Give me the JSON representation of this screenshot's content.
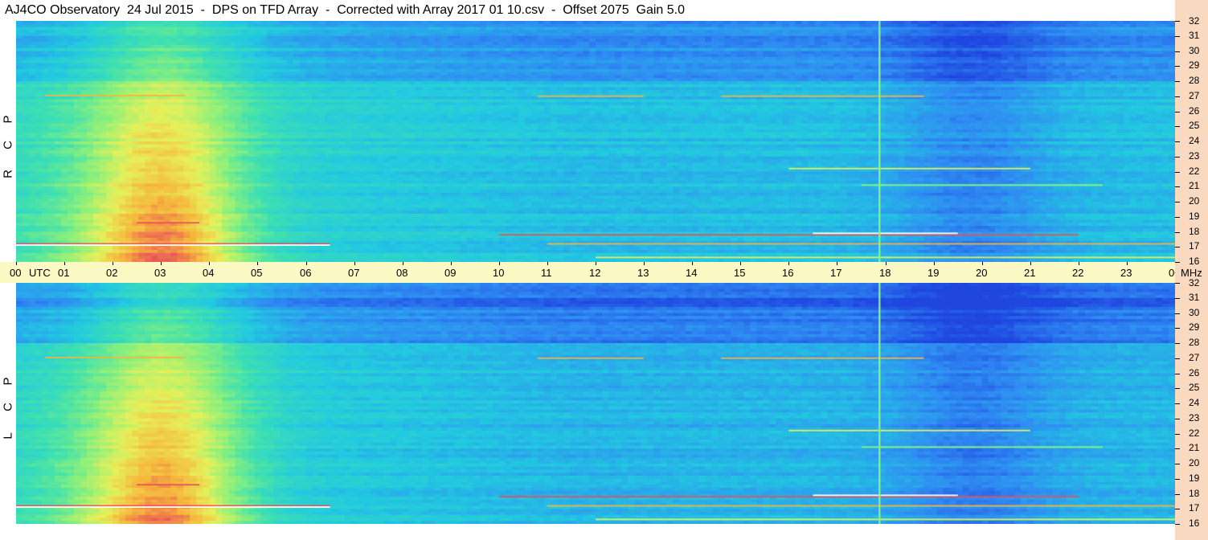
{
  "title": "AJ4CO Observatory  24 Jul 2015  -  DPS on TFD Array  -  Corrected with Array 2017 01 10.csv  -  Offset 2075  Gain 5.0",
  "chart_data": {
    "type": "heatmap",
    "title": "AJ4CO Observatory  24 Jul 2015  -  DPS on TFD Array  -  Corrected with Array 2017 01 10.csv  -  Offset 2075  Gain 5.0",
    "x_axis": {
      "unit_label": "UTC",
      "range": [
        0,
        24
      ],
      "tick_labels": [
        "00",
        "01",
        "02",
        "03",
        "04",
        "05",
        "06",
        "07",
        "08",
        "09",
        "10",
        "11",
        "12",
        "13",
        "14",
        "15",
        "16",
        "17",
        "18",
        "19",
        "20",
        "21",
        "22",
        "23",
        "00"
      ]
    },
    "y_axis": {
      "unit_label": "MHz",
      "range": [
        16,
        32
      ],
      "tick_labels": [
        "32",
        "31",
        "30",
        "29",
        "28",
        "27",
        "26",
        "25",
        "24",
        "23",
        "22",
        "21",
        "20",
        "19",
        "18",
        "17",
        "16"
      ]
    },
    "panels": [
      {
        "polarization": [
          "R",
          "C",
          "P"
        ]
      },
      {
        "polarization": [
          "L",
          "C",
          "P"
        ]
      }
    ],
    "colormap": [
      "#1f47e0",
      "#2f8cf2",
      "#22c9e0",
      "#3fe0b0",
      "#8ef07a",
      "#e6f05a",
      "#f6b43c",
      "#e8505a",
      "#ffffff"
    ]
  }
}
